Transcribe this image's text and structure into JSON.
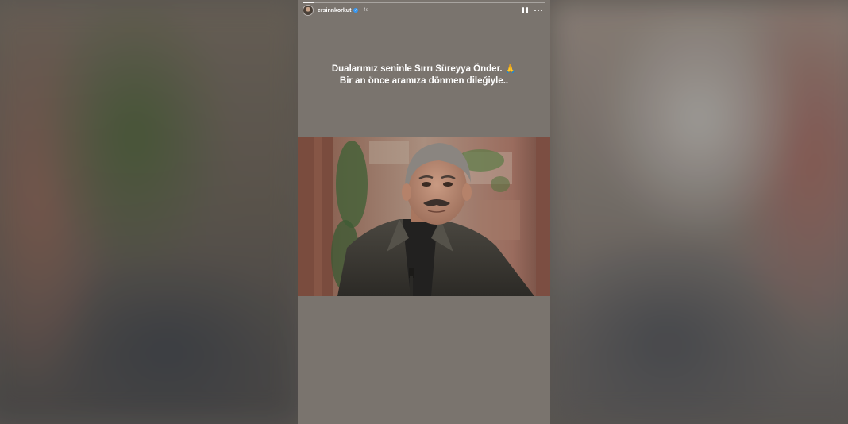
{
  "story": {
    "username": "ersinnkorkut",
    "verified": true,
    "time_ago": "4s",
    "progress": 0.05,
    "caption_line1": "Dualarımız seninle Sırrı Süreyya Önder.",
    "caption_emoji": "🙏",
    "caption_line2": "Bir an önce aramıza dönmen dileğiyle.."
  },
  "icons": {
    "pause": "pause-icon",
    "more": "more-icon",
    "verified": "verified-icon"
  },
  "colors": {
    "story_background": "#7a746e",
    "verified_badge": "#3897f0"
  }
}
